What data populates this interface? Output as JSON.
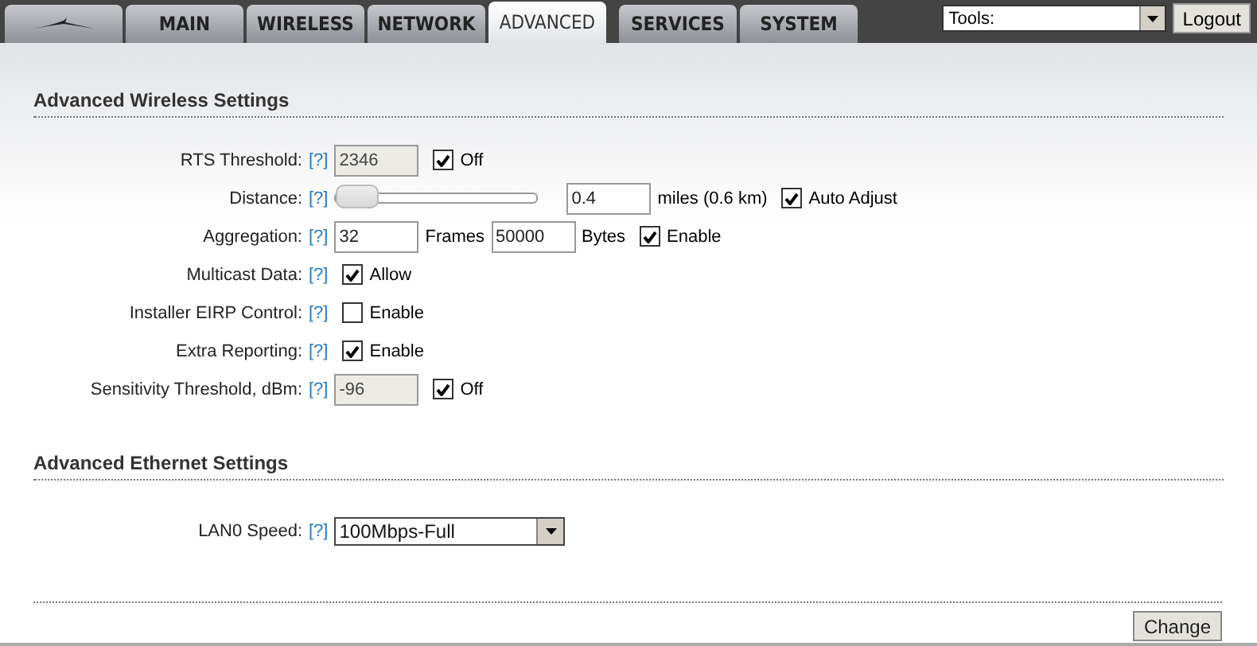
{
  "tabs": [
    {
      "kind": "logo",
      "selected": false
    },
    {
      "kind": "text",
      "label": "MAIN",
      "selected": false
    },
    {
      "kind": "text",
      "label": "WIRELESS",
      "selected": false
    },
    {
      "kind": "text",
      "label": "NETWORK",
      "selected": false
    },
    {
      "kind": "text",
      "label": "ADVANCED",
      "selected": true
    },
    {
      "kind": "text",
      "label": "SERVICES",
      "selected": false
    },
    {
      "kind": "text",
      "label": "SYSTEM",
      "selected": false
    }
  ],
  "tools": {
    "value": "Tools:"
  },
  "logout": "Logout",
  "sections": [
    {
      "title": "Advanced Wireless Settings",
      "rows": [
        {
          "label": "RTS Threshold:",
          "help": "[?]",
          "controls": [
            {
              "kind": "field",
              "value": "2346",
              "disabled": true
            },
            {
              "kind": "checkbox",
              "checked": true,
              "label": "Off"
            }
          ]
        },
        {
          "label": "Distance:",
          "help": "[?]",
          "controls": [
            {
              "kind": "slider",
              "level": 0
            },
            {
              "kind": "field",
              "value": "0.4",
              "disabled": false
            },
            {
              "kind": "text",
              "text": "miles (0.6 km)"
            },
            {
              "kind": "checkbox",
              "checked": true,
              "label": "Auto Adjust"
            }
          ]
        },
        {
          "label": "Aggregation:",
          "help": "[?]",
          "controls": [
            {
              "kind": "field",
              "value": "32",
              "disabled": false
            },
            {
              "kind": "text",
              "text": "Frames"
            },
            {
              "kind": "field",
              "value": "50000",
              "disabled": false
            },
            {
              "kind": "text",
              "text": "Bytes"
            },
            {
              "kind": "checkbox",
              "checked": true,
              "label": "Enable"
            }
          ]
        },
        {
          "label": "Multicast Data:",
          "help": "[?]",
          "controls": [
            {
              "kind": "checkbox",
              "checked": true,
              "label": "Allow"
            }
          ]
        },
        {
          "label": "Installer EIRP Control:",
          "help": "[?]",
          "controls": [
            {
              "kind": "checkbox",
              "checked": false,
              "label": "Enable"
            }
          ]
        },
        {
          "label": "Extra Reporting:",
          "help": "[?]",
          "controls": [
            {
              "kind": "checkbox",
              "checked": true,
              "label": "Enable"
            }
          ]
        },
        {
          "label": "Sensitivity Threshold, dBm:",
          "help": "[?]",
          "controls": [
            {
              "kind": "field",
              "value": "-96",
              "disabled": true
            },
            {
              "kind": "checkbox",
              "checked": true,
              "label": "Off"
            }
          ]
        }
      ]
    },
    {
      "title": "Advanced Ethernet Settings",
      "rows": [
        {
          "label": "LAN0 Speed:",
          "help": "[?]",
          "controls": [
            {
              "kind": "select",
              "value": "100Mbps-Full"
            }
          ]
        }
      ]
    }
  ],
  "change": "Change"
}
